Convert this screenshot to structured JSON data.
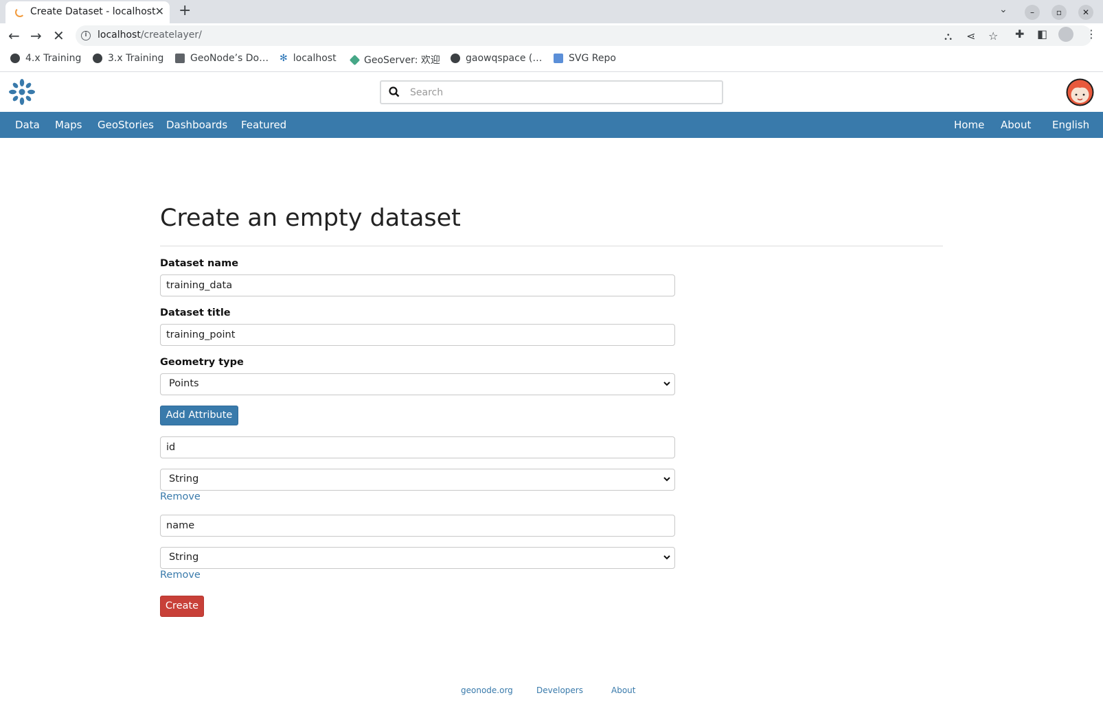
{
  "browser": {
    "tab_title": "Create Dataset - localhost",
    "url_host": "localhost",
    "url_path": "/createlayer/",
    "bookmarks": [
      "4.x Training",
      "3.x Training",
      "GeoNode’s Do…",
      "localhost",
      "GeoServer: 欢迎",
      "gaowqspace (…",
      "SVG Repo"
    ]
  },
  "header": {
    "search_placeholder": "Search"
  },
  "nav": {
    "left": [
      "Data",
      "Maps",
      "GeoStories",
      "Dashboards",
      "Featured"
    ],
    "right": [
      "Home",
      "About",
      "English"
    ]
  },
  "form": {
    "title": "Create an empty dataset",
    "dataset_name_label": "Dataset name",
    "dataset_name_value": "training_data",
    "dataset_title_label": "Dataset title",
    "dataset_title_value": "training_point",
    "geometry_label": "Geometry type",
    "geometry_value": "Points",
    "add_attribute_label": "Add Attribute",
    "attributes": [
      {
        "name": "id",
        "type": "String",
        "remove_label": "Remove"
      },
      {
        "name": "name",
        "type": "String",
        "remove_label": "Remove"
      }
    ],
    "create_label": "Create"
  },
  "footer": {
    "links": [
      "geonode.org",
      "Developers",
      "About"
    ]
  },
  "colors": {
    "brand_blue": "#397aab",
    "create_red": "#c84038"
  }
}
